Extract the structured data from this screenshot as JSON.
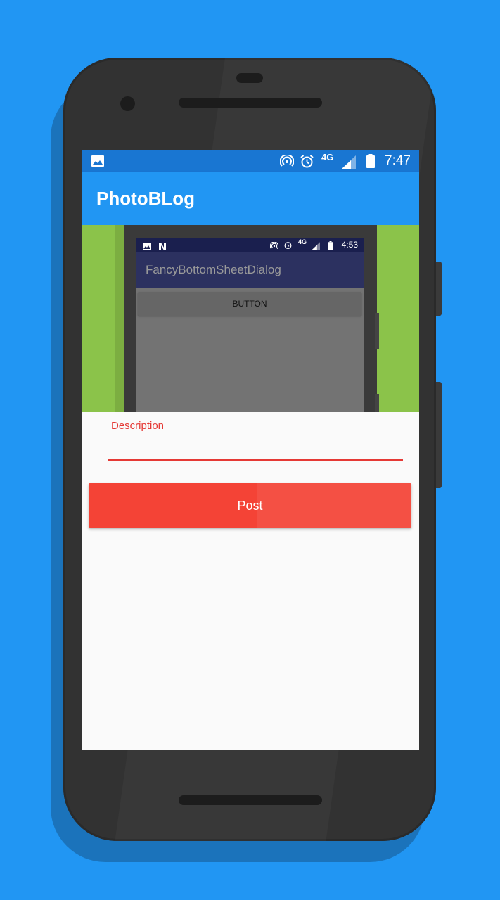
{
  "status_bar": {
    "time": "7:47",
    "network": "4G",
    "icons": [
      "image-icon",
      "hotspot-icon",
      "alarm-icon",
      "signal-icon",
      "battery-icon"
    ]
  },
  "app_bar": {
    "title": "PhotoBLog"
  },
  "photo_preview": {
    "status_bar": {
      "time": "4:53",
      "network": "4G"
    },
    "app_title": "FancyBottomSheetDialog",
    "button_label": "BUTTON"
  },
  "form": {
    "description_label": "Description",
    "description_value": "",
    "post_label": "Post"
  },
  "colors": {
    "background": "#2196F3",
    "primary": "#2196F3",
    "primary_dark": "#1976D2",
    "accent": "#F44336",
    "photo_green": "#8BC34A"
  }
}
